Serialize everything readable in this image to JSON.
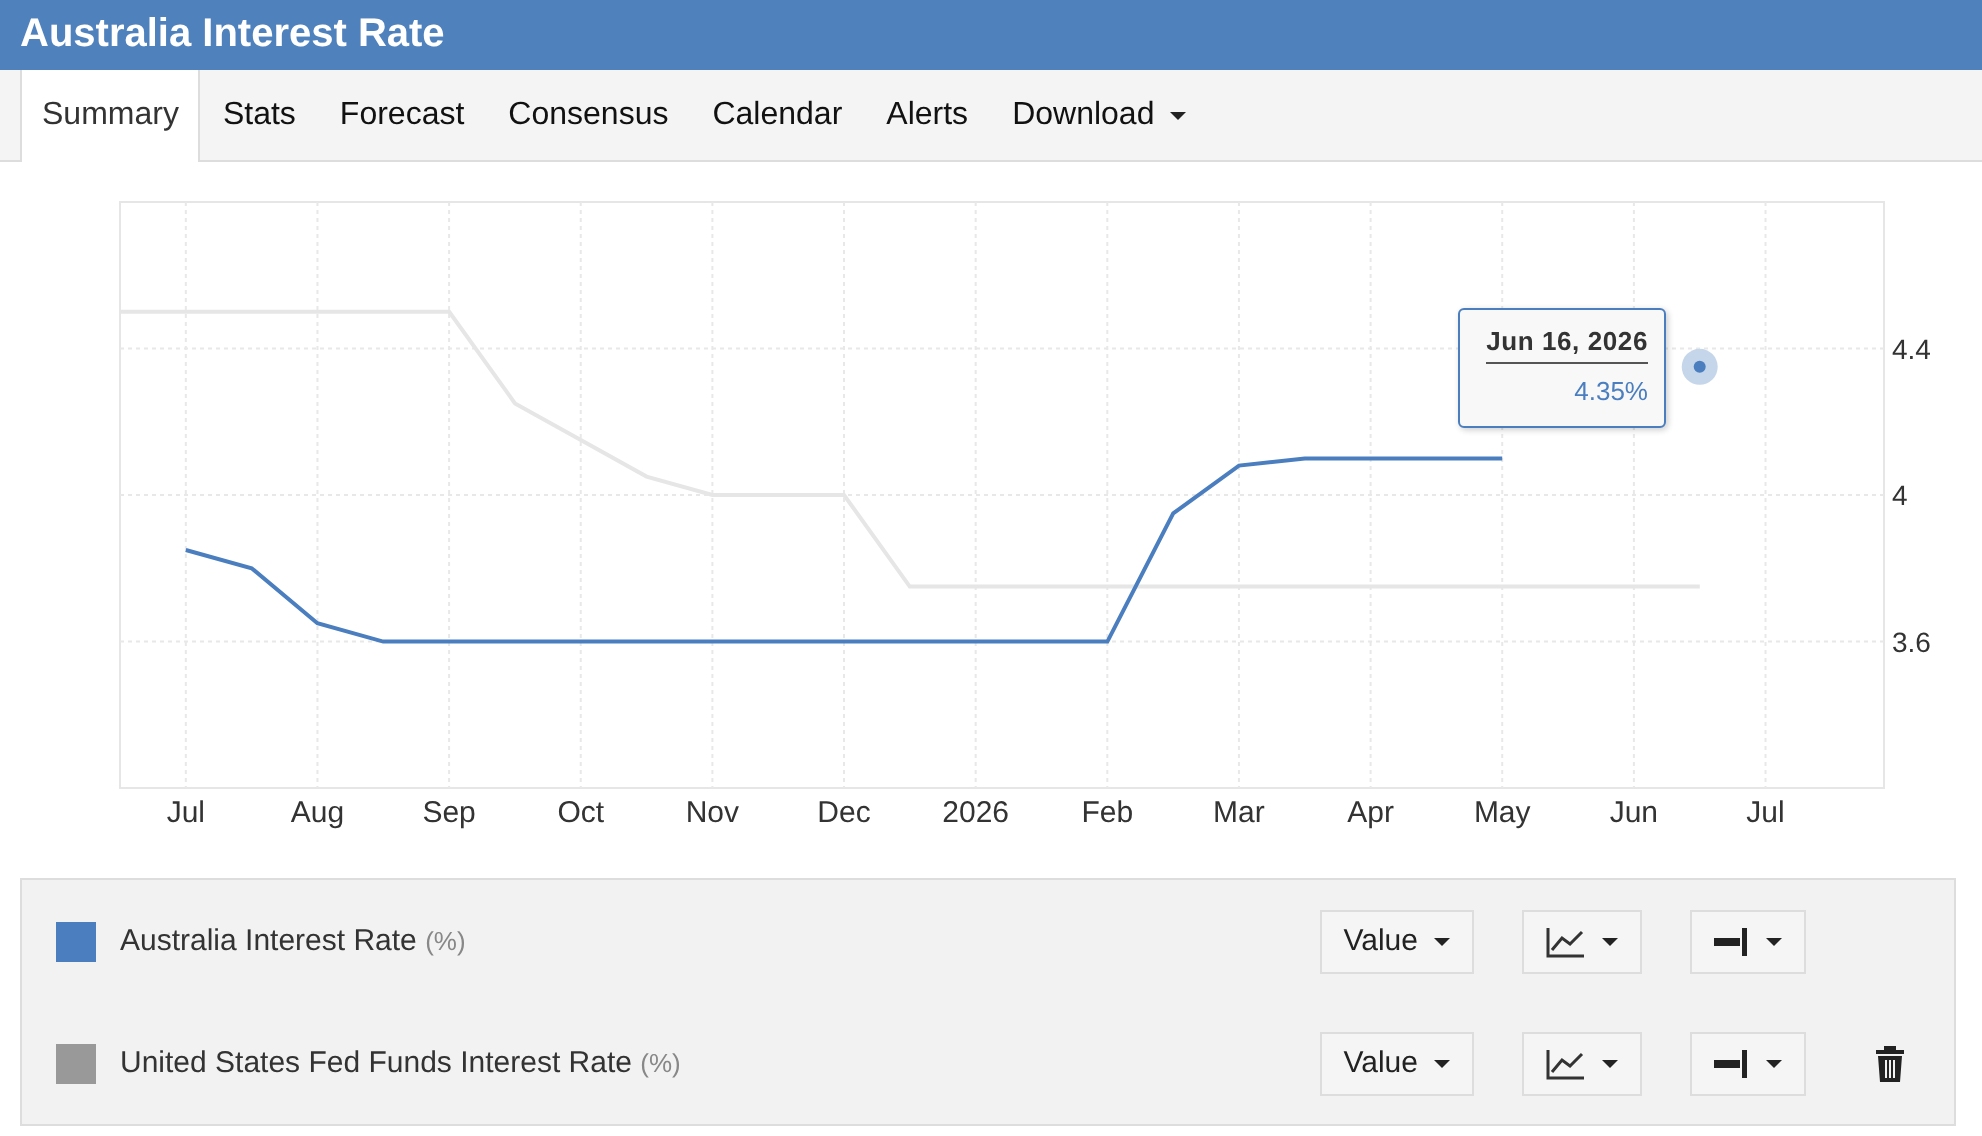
{
  "title": "Australia Interest Rate",
  "tabs": [
    {
      "label": "Summary",
      "selected": true
    },
    {
      "label": "Stats",
      "selected": false
    },
    {
      "label": "Forecast",
      "selected": false
    },
    {
      "label": "Consensus",
      "selected": false
    },
    {
      "label": "Calendar",
      "selected": false
    },
    {
      "label": "Alerts",
      "selected": false
    },
    {
      "label": "Download",
      "selected": false,
      "dropdown": true
    }
  ],
  "chart_data": {
    "type": "line",
    "categories": [
      null,
      "Jul",
      null,
      "Aug",
      null,
      "Sep",
      null,
      "Oct",
      null,
      "Nov",
      null,
      "Dec",
      null,
      "2026",
      null,
      "Feb",
      null,
      "Mar",
      null,
      "Apr",
      null,
      "May",
      null,
      "Jun",
      null,
      "Jul",
      null
    ],
    "ylim": [
      3.2,
      4.8
    ],
    "grid": true,
    "yticks": [
      3.6,
      4,
      4.4
    ],
    "series": [
      {
        "name": "Australia Interest Rate",
        "color": "#4a7ebf",
        "values": [
          null,
          3.85,
          3.8,
          3.65,
          3.6,
          3.6,
          3.6,
          3.6,
          3.6,
          3.6,
          3.6,
          3.6,
          3.6,
          3.6,
          3.6,
          3.6,
          3.95,
          4.08,
          4.1,
          4.1,
          4.1,
          4.1,
          null,
          null,
          4.35,
          null,
          null
        ]
      },
      {
        "name": "United States Fed Funds Interest Rate",
        "color": "#e6e6e6",
        "values": [
          4.5,
          4.5,
          4.5,
          4.5,
          4.5,
          4.5,
          4.25,
          4.15,
          4.05,
          4.0,
          4.0,
          4.0,
          3.75,
          3.75,
          3.75,
          3.75,
          3.75,
          3.75,
          3.75,
          3.75,
          3.75,
          3.75,
          3.75,
          3.75,
          3.75,
          null,
          null
        ]
      }
    ]
  },
  "tooltip": {
    "date": "Jun 16, 2026",
    "value": "4.35%"
  },
  "legend": [
    {
      "unit": "(%)",
      "color": "#4a7ebf",
      "value_menu": "Value",
      "deletable": false
    },
    {
      "unit": "(%)",
      "color": "#999999",
      "value_menu": "Value",
      "deletable": true
    }
  ]
}
